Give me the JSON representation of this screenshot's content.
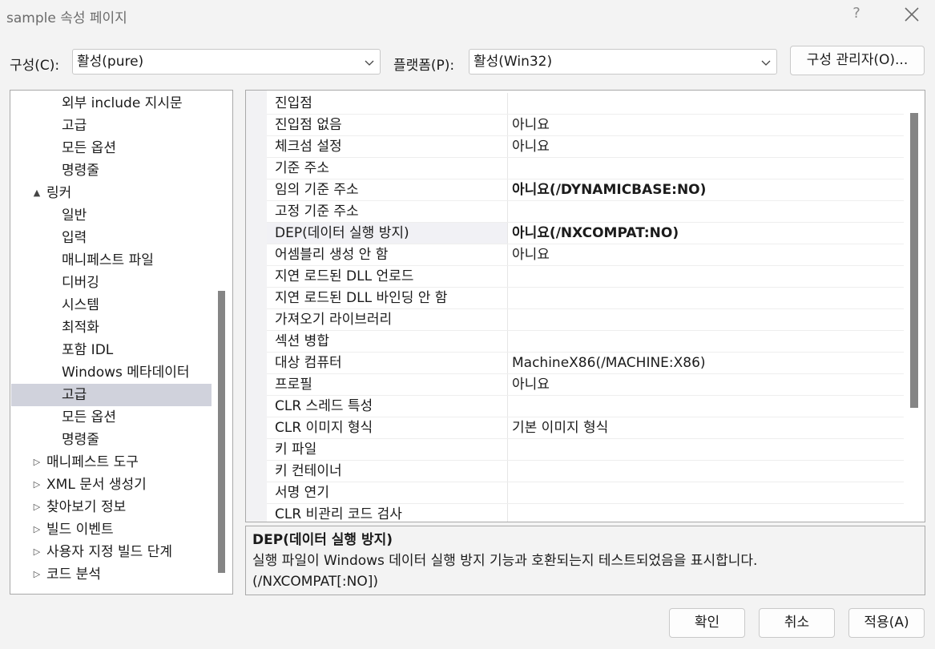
{
  "window": {
    "title": "sample 속성 페이지",
    "help_glyph": "?"
  },
  "toolbar": {
    "config_label": "구성(C):",
    "config_value": "활성(pure)",
    "platform_label": "플랫폼(P):",
    "platform_value": "활성(Win32)",
    "config_manager_label": "구성 관리자(O)..."
  },
  "tree": {
    "items": [
      {
        "label": "외부 include 지시문",
        "level": 2,
        "expander": ""
      },
      {
        "label": "고급",
        "level": 2,
        "expander": ""
      },
      {
        "label": "모든 옵션",
        "level": 2,
        "expander": ""
      },
      {
        "label": "명령줄",
        "level": 2,
        "expander": ""
      },
      {
        "label": "링커",
        "level": 1,
        "expander": "▲"
      },
      {
        "label": "일반",
        "level": 2,
        "expander": ""
      },
      {
        "label": "입력",
        "level": 2,
        "expander": ""
      },
      {
        "label": "매니페스트 파일",
        "level": 2,
        "expander": ""
      },
      {
        "label": "디버깅",
        "level": 2,
        "expander": ""
      },
      {
        "label": "시스템",
        "level": 2,
        "expander": ""
      },
      {
        "label": "최적화",
        "level": 2,
        "expander": ""
      },
      {
        "label": "포함 IDL",
        "level": 2,
        "expander": ""
      },
      {
        "label": "Windows 메타데이터",
        "level": 2,
        "expander": ""
      },
      {
        "label": "고급",
        "level": 2,
        "expander": "",
        "selected": true
      },
      {
        "label": "모든 옵션",
        "level": 2,
        "expander": ""
      },
      {
        "label": "명령줄",
        "level": 2,
        "expander": ""
      },
      {
        "label": "매니페스트 도구",
        "level": 1,
        "expander": "▷"
      },
      {
        "label": "XML 문서 생성기",
        "level": 1,
        "expander": "▷"
      },
      {
        "label": "찾아보기 정보",
        "level": 1,
        "expander": "▷"
      },
      {
        "label": "빌드 이벤트",
        "level": 1,
        "expander": "▷"
      },
      {
        "label": "사용자 지정 빌드 단계",
        "level": 1,
        "expander": "▷"
      },
      {
        "label": "코드 분석",
        "level": 1,
        "expander": "▷"
      }
    ]
  },
  "grid": {
    "rows": [
      {
        "name": "진입점",
        "value": ""
      },
      {
        "name": "진입점 없음",
        "value": "아니요"
      },
      {
        "name": "체크섬 설정",
        "value": "아니요"
      },
      {
        "name": "기준 주소",
        "value": ""
      },
      {
        "name": "임의 기준 주소",
        "value": "아니요(/DYNAMICBASE:NO)",
        "bold": true
      },
      {
        "name": "고정 기준 주소",
        "value": ""
      },
      {
        "name": "DEP(데이터 실행 방지)",
        "value": "아니요(/NXCOMPAT:NO)",
        "bold": true,
        "selected": true
      },
      {
        "name": "어셈블리 생성 안 함",
        "value": "아니요"
      },
      {
        "name": "지연 로드된 DLL 언로드",
        "value": ""
      },
      {
        "name": "지연 로드된 DLL 바인딩 안 함",
        "value": ""
      },
      {
        "name": "가져오기 라이브러리",
        "value": ""
      },
      {
        "name": "섹션 병합",
        "value": ""
      },
      {
        "name": "대상 컴퓨터",
        "value": "MachineX86(/MACHINE:X86)"
      },
      {
        "name": "프로필",
        "value": "아니요"
      },
      {
        "name": "CLR 스레드 특성",
        "value": ""
      },
      {
        "name": "CLR 이미지 형식",
        "value": "기본 이미지 형식"
      },
      {
        "name": "키 파일",
        "value": ""
      },
      {
        "name": "키 컨테이너",
        "value": ""
      },
      {
        "name": "서명 연기",
        "value": ""
      },
      {
        "name": "CLR 비관리 코드 검사",
        "value": ""
      }
    ]
  },
  "description": {
    "title": "DEP(데이터 실행 방지)",
    "line1": "실행 파일이 Windows 데이터 실행 방지 기능과 호환되는지 테스트되었음을 표시합니다.",
    "line2": "(/NXCOMPAT[:NO])"
  },
  "buttons": {
    "ok": "확인",
    "cancel": "취소",
    "apply": "적용(A)"
  }
}
